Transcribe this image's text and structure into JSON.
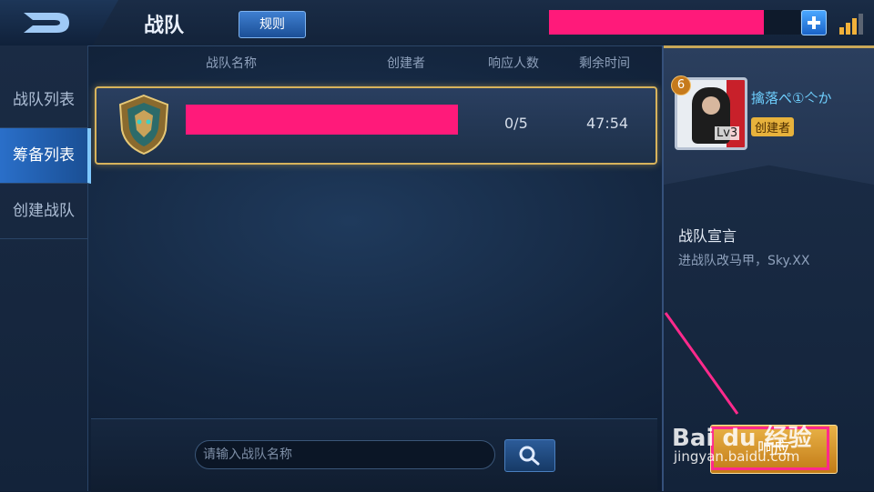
{
  "header": {
    "title": "战队",
    "rules_label": "规则"
  },
  "sidebar": {
    "items": [
      {
        "label": "战队列表"
      },
      {
        "label": "筹备列表"
      },
      {
        "label": "创建战队"
      }
    ]
  },
  "table": {
    "columns": [
      "战队名称",
      "创建者",
      "响应人数",
      "剩余时间"
    ],
    "rows": [
      {
        "response_count": "0/5",
        "time_remaining": "47:54"
      }
    ]
  },
  "search": {
    "placeholder": "请输入战队名称",
    "value": ""
  },
  "creator": {
    "name": "擒落ぺ①亽か",
    "level_badge": "6",
    "lv_label": "Lv3",
    "tag": "创建者"
  },
  "declaration": {
    "title": "战队宣言",
    "text": "进战队改马甲，Sky.XX"
  },
  "actions": {
    "respond_label": "响应"
  },
  "watermark": {
    "title": "Bai du 经验",
    "url": "jingyan.baidu.com"
  },
  "colors": {
    "accent_gold": "#d7b35c",
    "redaction": "#ff1a7a",
    "active_tab": "#2a6fc9",
    "name_cyan": "#6fd0ff"
  }
}
